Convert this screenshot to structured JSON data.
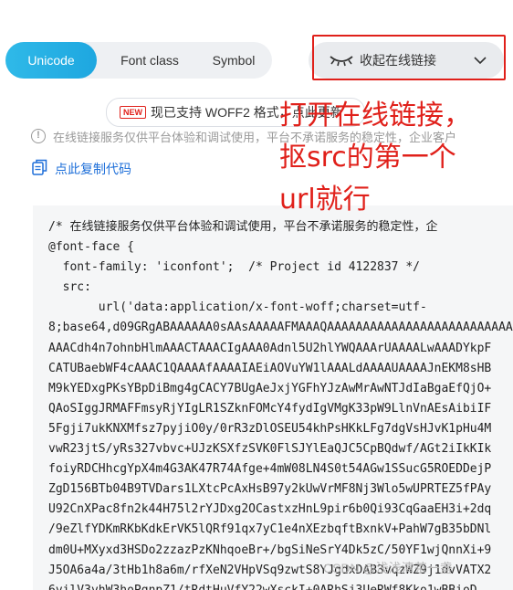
{
  "tabs": [
    {
      "label": "Unicode",
      "active": true
    },
    {
      "label": "Font class",
      "active": false
    },
    {
      "label": "Symbol",
      "active": false
    }
  ],
  "toggle": {
    "label": "收起在线链接",
    "icon": "eye-closed-icon"
  },
  "notice": {
    "badge": "NEW",
    "text": "现已支持 WOFF2 格式，点此更新"
  },
  "info": {
    "text": "在线链接服务仅供平台体验和调试使用，平台不承诺服务的稳定性，企业客户"
  },
  "copy": {
    "label": "点此复制代码"
  },
  "code": {
    "lines": [
      "/* 在线链接服务仅供平台体验和调试使用，平台不承诺服务的稳定性，企",
      "@font-face {",
      "  font-family: 'iconfont';  /* Project id 4122837 */",
      "  src:",
      "       url('data:application/x-font-woff;charset=utf-",
      "8;base64,d09GRgABAAAAAA0sAAsAAAAAFMAAAQAAAAAAAAAAAAAAAAAAAAAAAAAAAA",
      "AAACdh4n7ohnbHlmAAACTAAACIgAAA0Adnl5U2hlYWQAAArUAAAALwAAADYkpF",
      "CATUBaebWF4cAAAC1QAAAAfAAAAIAEiAOVuYW1lAAALdAAAAUAAAAJnEKM8sHB",
      "M9kYEDxgPKsYBpDiBmg4gCACY7BUgAeJxjYGFhYJzAwMrAwNTJdIaBgaEfQjO+",
      "QAoSIggJRMAFFmsyRjYIgLR1SZknFOMcY4fydIgVMgK33pW9LlnVnAEsAibiIF",
      "5Fgji7ukKNXMfsz7pyjiO0y/0rR3zDlOSEU54khPsHKkLFg7dgVsHJvK1pHu4M",
      "vwR23jtS/yRs327vbvc+UJzKSXfzSVK0FlSJYlEaQJC5CpBQdwf/AGt2iIkKIk",
      "foiyRDCHhcgYpX4m4G3AK47R74Afge+4mW08LN4S0t54AGw1SSucG5ROEDDejP",
      "ZgD156BTb04B9TVDars1LXtcPcAxHsB97y2kUwVrMF8Nj3Wlo5wUPRTEZ5fPAy",
      "U92CnXPac8fn2k44H75l2rYJDxg2OCastxzHnL9pir6b0Qi93CqGaaEH3i+2dq",
      "/9eZlfYDKmRKbKdkErVK5lQRf91qx7yC1e4nXEzbqftBxnkV+PahW7gB35bDNl",
      "dm0U+MXyxd3HSDo2zzazPzKNhqoeBr+/bgSiNeSrY4Dk5zC/50YF1wjQnnXi+9",
      "J5OA6a4a/3tHb1h8a6m/rfXeN2VHpVSq9zwtS8YJgdxDAB3vqzWZ9j1dvVATX2",
      "6vilV3vhW3hoPgnpZ1/tRdtHuVfY22wXsckI+0ARhSj3UeRWf8Kko1wBBioD"
    ]
  },
  "annotation": {
    "lines": [
      "打开在线链接，",
      "抠src的第一个",
      "url就行"
    ]
  },
  "watermark": "CSDN @浅浅清茶一盏"
}
